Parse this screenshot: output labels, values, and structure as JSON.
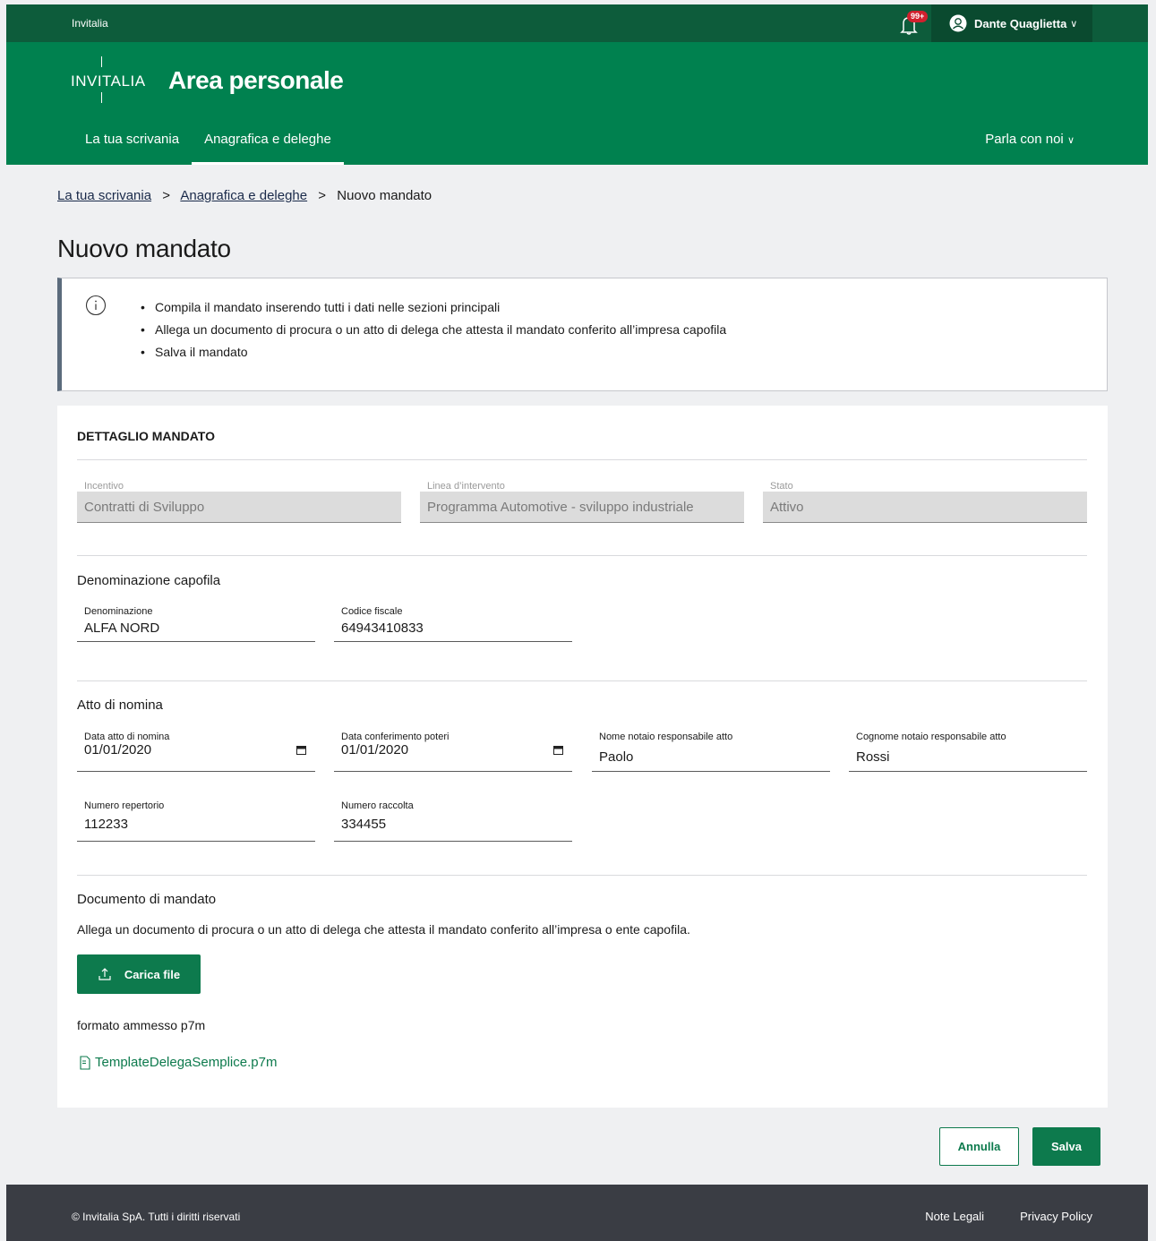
{
  "topbar": {
    "brand": "Invitalia",
    "notifications_badge": "99+",
    "user_name": "Dante Quaglietta"
  },
  "header": {
    "logo_text": "INVITALIA",
    "title": "Area personale",
    "nav": [
      "La tua scrivania",
      "Anagrafica e deleghe"
    ],
    "talk_label": "Parla con noi"
  },
  "breadcrumb": {
    "items": [
      "La tua scrivania",
      "Anagrafica e deleghe"
    ],
    "current": "Nuovo mandato",
    "separator": ">"
  },
  "page_title": "Nuovo mandato",
  "info": {
    "items": [
      "Compila il mandato inserendo tutti i dati nelle sezioni principali",
      "Allega un documento di procura o un atto di delega che attesta il mandato conferito all’impresa capofila",
      "Salva il mandato"
    ]
  },
  "detail": {
    "title": "DETTAGLIO MANDATO",
    "incentivo": {
      "label": "Incentivo",
      "value": "Contratti di Sviluppo"
    },
    "linea": {
      "label": "Linea d’intervento",
      "value": "Programma Automotive - sviluppo industriale"
    },
    "stato": {
      "label": "Stato",
      "value": "Attivo"
    }
  },
  "capofila": {
    "title": "Denominazione capofila",
    "denominazione": {
      "label": "Denominazione",
      "value": "ALFA NORD"
    },
    "codice_fiscale": {
      "label": "Codice fiscale",
      "value": "64943410833"
    }
  },
  "atto": {
    "title": "Atto di nomina",
    "data_atto": {
      "label": "Data atto di nomina",
      "value": "01/01/2020"
    },
    "data_conferimento": {
      "label": "Data conferimento poteri",
      "value": "01/01/2020"
    },
    "nome_notaio": {
      "label": "Nome notaio responsabile atto",
      "value": "Paolo"
    },
    "cognome_notaio": {
      "label": "Cognome notaio responsabile atto",
      "value": "Rossi"
    },
    "numero_repertorio": {
      "label": "Numero repertorio",
      "value": "112233"
    },
    "numero_raccolta": {
      "label": "Numero raccolta",
      "value": "334455"
    }
  },
  "documento": {
    "title": "Documento di mandato",
    "description": "Allega un documento di procura o un atto di delega che attesta il mandato conferito all’impresa o ente capofila.",
    "upload_label": "Carica file",
    "format_note": "formato ammesso p7m",
    "template_link": "TemplateDelegaSemplice.p7m"
  },
  "actions": {
    "cancel": "Annulla",
    "save": "Salva"
  },
  "footer": {
    "copyright": "© Invitalia SpA. Tutti i diritti riservati",
    "links": [
      "Note Legali",
      "Privacy Policy"
    ]
  },
  "colors": {
    "brand_green": "#00814f",
    "dark_green": "#0d5c3b",
    "button_green": "#0d7a4d",
    "footer": "#3a3d44"
  }
}
